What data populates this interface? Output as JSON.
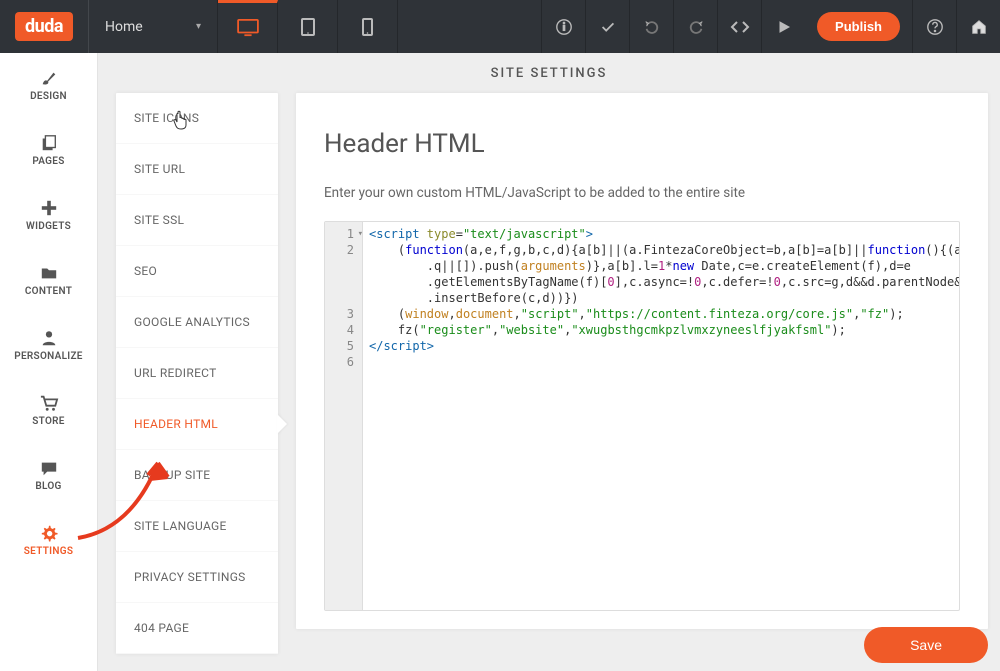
{
  "brand": "duda",
  "page_dropdown": {
    "label": "Home"
  },
  "topbar": {
    "publish_label": "Publish"
  },
  "rail": [
    {
      "label": "DESIGN"
    },
    {
      "label": "PAGES"
    },
    {
      "label": "WIDGETS"
    },
    {
      "label": "CONTENT"
    },
    {
      "label": "PERSONALIZE"
    },
    {
      "label": "STORE"
    },
    {
      "label": "BLOG"
    },
    {
      "label": "SETTINGS"
    }
  ],
  "section_title": "SITE SETTINGS",
  "submenu": [
    {
      "label": "SITE ICONS"
    },
    {
      "label": "SITE URL"
    },
    {
      "label": "SITE SSL"
    },
    {
      "label": "SEO"
    },
    {
      "label": "GOOGLE ANALYTICS"
    },
    {
      "label": "URL REDIRECT"
    },
    {
      "label": "HEADER HTML",
      "active": true
    },
    {
      "label": "BACKUP SITE"
    },
    {
      "label": "SITE LANGUAGE"
    },
    {
      "label": "PRIVACY SETTINGS"
    },
    {
      "label": "404 PAGE"
    }
  ],
  "panel": {
    "title": "Header HTML",
    "hint": "Enter your own custom HTML/JavaScript to be added to the entire site",
    "save_label": "Save",
    "code": {
      "line_numbers": [
        "1",
        "2",
        "3",
        "4",
        "5",
        "6"
      ],
      "l1": {
        "open": "<script ",
        "attr1": "type",
        "eq": "=",
        "val1": "\"text/javascript\"",
        "close": ">"
      },
      "l2": {
        "a": "    (",
        "fn": "function",
        "b": "(a,e,f,g,b,c,d){a[b]||(a.FintezaCoreObject=b,a[b]=a[b]||",
        "fn2": "function",
        "c": "(){(a[b].q=a[b]",
        "d": "        .q||[]).push(",
        "arg": "arguments",
        "e": ")},a[b].l=",
        "num1": "1",
        "f": "*",
        "new": "new",
        "g": " Date,c=e.createElement(f),d=e",
        "h": "        .getElementsByTagName(f)[",
        "num0": "0",
        "i": "],c.async=!",
        "j": ",c.defer=!",
        "k": ",c.src=g,d&&d.parentNode&&d.parentNode",
        "l": "        .insertBefore(c,d))})"
      },
      "l3": {
        "a": "    (",
        "w": "window",
        "c1": ",",
        "d": "document",
        "c2": ",",
        "s1": "\"script\"",
        "c3": ",",
        "s2": "\"https://content.finteza.org/core.js\"",
        "c4": ",",
        "s3": "\"fz\"",
        "e": ");"
      },
      "l4": {
        "a": "    fz(",
        "s1": "\"register\"",
        "c1": ",",
        "s2": "\"website\"",
        "c2": ",",
        "s3": "\"xwugbsthgcmkpzlvmxzyneeslfjyakfsml\"",
        "e": ");"
      },
      "l5": {
        "close": "</script",
        "gt": ">"
      }
    }
  }
}
